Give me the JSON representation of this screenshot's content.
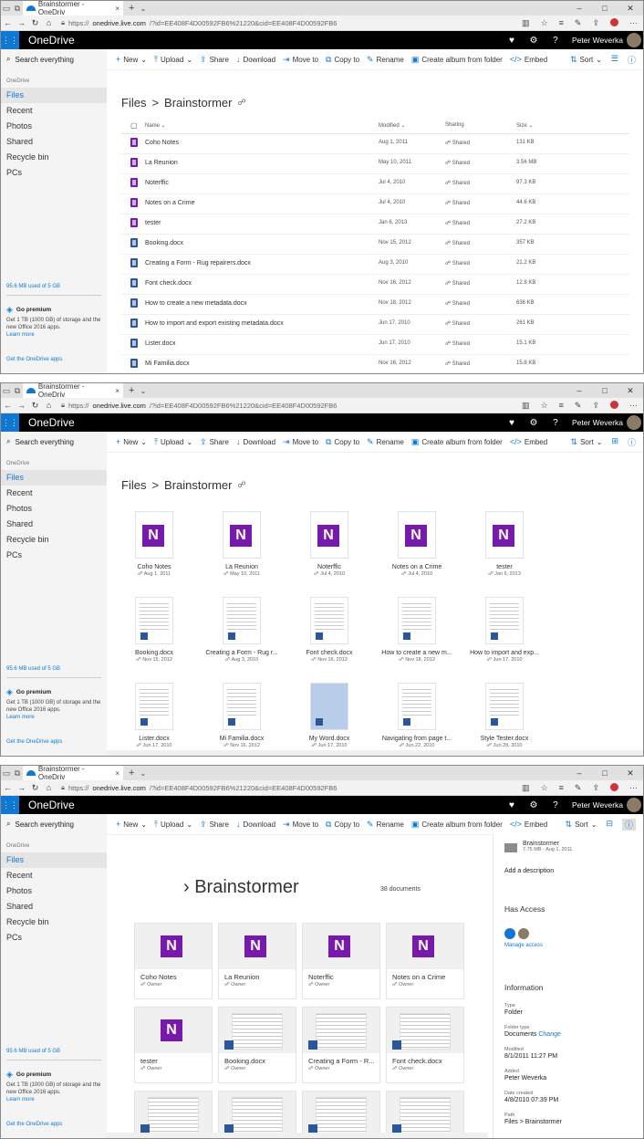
{
  "browser": {
    "tab_title": "Brainstormer - OneDriv",
    "url_prefix": "https://",
    "url_host": "onedrive.live.com",
    "url_list": "/?id=EE408F4D00592FB6%21220&cid=EE408F4D00592FB6",
    "url_tiles": "/?id=EE408F4D00592FB6%21220&cid=EE408F4D00592FB6"
  },
  "app": {
    "brand": "OneDrive",
    "user": "Peter Weverka"
  },
  "search": {
    "placeholder": "Search everything"
  },
  "commands": {
    "new": "New",
    "upload": "Upload",
    "share": "Share",
    "download": "Download",
    "move": "Move to",
    "copy": "Copy to",
    "rename": "Rename",
    "album": "Create album from folder",
    "embed": "Embed",
    "sort": "Sort"
  },
  "sidebar": {
    "section": "OneDrive",
    "items": [
      "Files",
      "Recent",
      "Photos",
      "Shared",
      "Recycle bin",
      "PCs"
    ],
    "storage": "95.6 MB used of 5 GB",
    "premium": "Go premium",
    "premium_desc": "Get 1 TB (1000 GB) of storage and the new Office 2016 apps.",
    "learn_more": "Learn more",
    "get_apps": "Get the OneDrive apps"
  },
  "breadcrumb": {
    "root": "Files",
    "sep": ">",
    "folder": "Brainstormer"
  },
  "list": {
    "headers": {
      "name": "Name",
      "modified": "Modified",
      "sharing": "Sharing",
      "size": "Size"
    },
    "rows": [
      {
        "name": "Coho Notes",
        "modified": "Aug 1, 2011",
        "sharing": "Shared",
        "size": "131 KB",
        "type": "one"
      },
      {
        "name": "La Reunion",
        "modified": "May 10, 2011",
        "sharing": "Shared",
        "size": "3.56 MB",
        "type": "one"
      },
      {
        "name": "Noterffic",
        "modified": "Jul 4, 2010",
        "sharing": "Shared",
        "size": "97.3 KB",
        "type": "one"
      },
      {
        "name": "Notes on a Crime",
        "modified": "Jul 4, 2010",
        "sharing": "Shared",
        "size": "44.6 KB",
        "type": "one"
      },
      {
        "name": "tester",
        "modified": "Jan 6, 2013",
        "sharing": "Shared",
        "size": "27.2 KB",
        "type": "one"
      },
      {
        "name": "Booking.docx",
        "modified": "Nov 15, 2012",
        "sharing": "Shared",
        "size": "357 KB",
        "type": "word"
      },
      {
        "name": "Creating a Form - Rug repairers.docx",
        "modified": "Aug 3, 2010",
        "sharing": "Shared",
        "size": "21.2 KB",
        "type": "word"
      },
      {
        "name": "Font check.docx",
        "modified": "Nov 16, 2012",
        "sharing": "Shared",
        "size": "12.8 KB",
        "type": "word"
      },
      {
        "name": "How to create a new metadata.docx",
        "modified": "Nov 18, 2012",
        "sharing": "Shared",
        "size": "636 KB",
        "type": "word"
      },
      {
        "name": "How to import and export existing metadata.docx",
        "modified": "Jun 17, 2010",
        "sharing": "Shared",
        "size": "261 KB",
        "type": "word"
      },
      {
        "name": "Lister.docx",
        "modified": "Jun 17, 2010",
        "sharing": "Shared",
        "size": "15.1 KB",
        "type": "word"
      },
      {
        "name": "Mi Familia.docx",
        "modified": "Nov 16, 2012",
        "sharing": "Shared",
        "size": "15.8 KB",
        "type": "word"
      }
    ]
  },
  "tiles": [
    {
      "name": "Coho Notes",
      "date": "Aug 1, 2011",
      "type": "one"
    },
    {
      "name": "La Reunion",
      "date": "May 10, 2011",
      "type": "one"
    },
    {
      "name": "Noterffic",
      "date": "Jul 4, 2010",
      "type": "one"
    },
    {
      "name": "Notes on a Crime",
      "date": "Jul 4, 2010",
      "type": "one"
    },
    {
      "name": "tester",
      "date": "Jan 6, 2013",
      "type": "one"
    },
    {
      "name": "Booking.docx",
      "date": "Nov 15, 2012",
      "type": "word"
    },
    {
      "name": "Creating a Form - Rug r...",
      "date": "Aug 3, 2010",
      "type": "word"
    },
    {
      "name": "Font check.docx",
      "date": "Nov 16, 2012",
      "type": "word"
    },
    {
      "name": "How to create a new m...",
      "date": "Nov 18, 2012",
      "type": "word"
    },
    {
      "name": "How to import and exp...",
      "date": "Jun 17, 2010",
      "type": "word"
    },
    {
      "name": "Lister.docx",
      "date": "Jun 17, 2010",
      "type": "word"
    },
    {
      "name": "Mi Familia.docx",
      "date": "Nov 16, 2012",
      "type": "word"
    },
    {
      "name": "My Word.docx",
      "date": "Jun 17, 2010",
      "type": "blue"
    },
    {
      "name": "Navigating from page t...",
      "date": "Jun 22, 2010",
      "type": "word"
    },
    {
      "name": "Style Tester.docx",
      "date": "Jun 28, 2010",
      "type": "word"
    }
  ],
  "photo_view": {
    "title": "Brainstormer",
    "count": "38 documents",
    "cards": [
      {
        "name": "Coho Notes",
        "owner": "Owner",
        "type": "one"
      },
      {
        "name": "La Reunion",
        "owner": "Owner",
        "type": "one"
      },
      {
        "name": "Noterffic",
        "owner": "Owner",
        "type": "one"
      },
      {
        "name": "Notes on a Crime",
        "owner": "Owner",
        "type": "one"
      },
      {
        "name": "tester",
        "owner": "Owner",
        "type": "one"
      },
      {
        "name": "Booking.docx",
        "owner": "Owner",
        "type": "word"
      },
      {
        "name": "Creating a Form - R...",
        "owner": "Owner",
        "type": "word"
      },
      {
        "name": "Font check.docx",
        "owner": "Owner",
        "type": "word"
      }
    ]
  },
  "details": {
    "name": "Brainstormer",
    "summary": "7.75 MB - Aug 1, 2011",
    "add_desc": "Add a description",
    "has_access": "Has Access",
    "manage_access": "Manage access",
    "information": "Information",
    "type_label": "Type",
    "type_value": "Folder",
    "folder_type_label": "Folder type",
    "folder_type_value": "Documents",
    "change": "Change",
    "modified_label": "Modified",
    "modified_value": "8/1/2011 11:27 PM",
    "added_label": "Added",
    "added_value": "Peter Weverka",
    "created_label": "Date created",
    "created_value": "4/8/2010 07:39 PM",
    "path_label": "Path",
    "path_value": "Files > Brainstormer"
  },
  "colors": {
    "accent": "#0f78d4",
    "onenote": "#7719aa",
    "word": "#2b579a"
  }
}
